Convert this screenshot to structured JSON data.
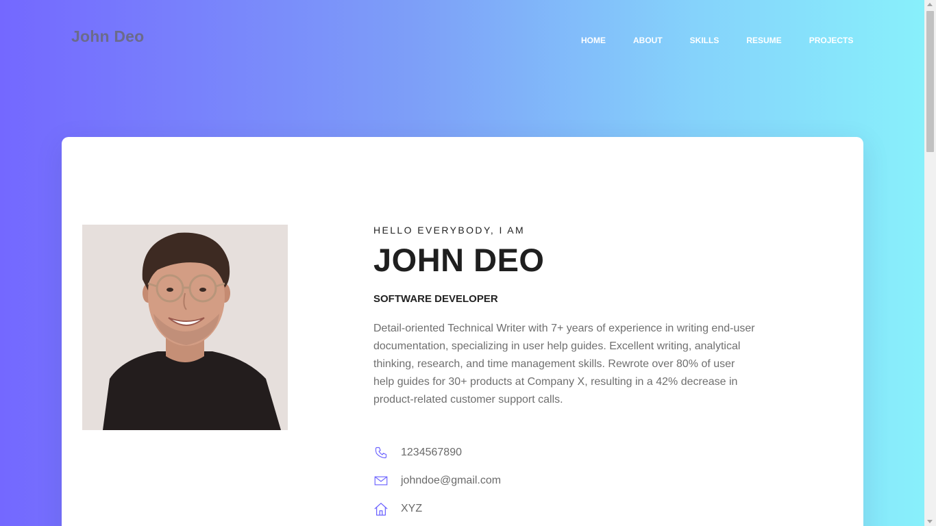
{
  "brand": "John Deo",
  "nav": [
    {
      "label": "HOME"
    },
    {
      "label": "ABOUT"
    },
    {
      "label": "SKILLS"
    },
    {
      "label": "RESUME"
    },
    {
      "label": "PROJECTS"
    }
  ],
  "hero": {
    "greeting": "HELLO EVERYBODY, I AM",
    "name": "JOHN DEO",
    "role": "SOFTWARE DEVELOPER",
    "bio": "Detail-oriented Technical Writer with 7+ years of experience in writing end-user documentation, specializing in user help guides. Excellent writing, analytical thinking, research, and time management skills. Rewrote over 80% of user help guides for 30+ products at Company X, resulting in a 42% decrease in product-related customer support calls."
  },
  "contacts": [
    {
      "icon": "phone-icon",
      "value": "1234567890"
    },
    {
      "icon": "mail-icon",
      "value": "johndoe@gmail.com"
    },
    {
      "icon": "home-icon",
      "value": "XYZ"
    }
  ],
  "colors": {
    "gradient_start": "#7468ff",
    "gradient_end": "#88f0fb",
    "icon_accent": "#6c63ff"
  }
}
